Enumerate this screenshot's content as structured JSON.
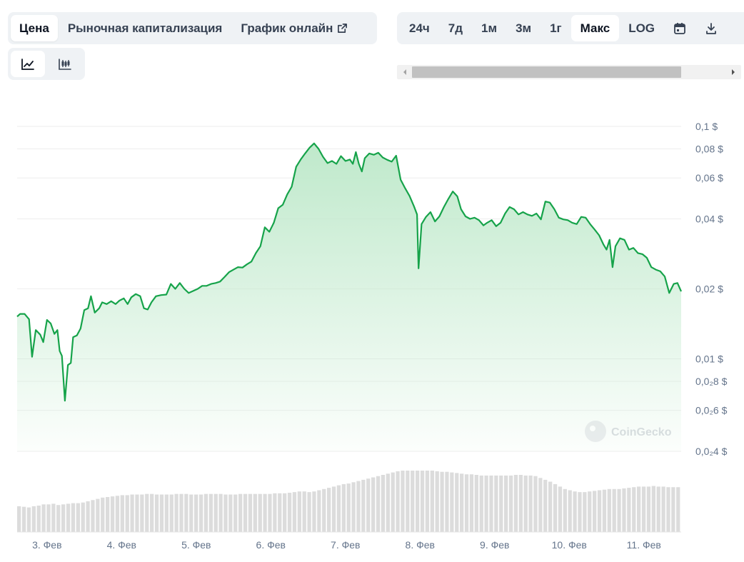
{
  "tabs": {
    "price": "Цена",
    "market_cap": "Рыночная капитализация",
    "live_chart": "График онлайн"
  },
  "chart_type_buttons": [
    {
      "name": "line-chart",
      "icon": "line-chart-icon",
      "active": true
    },
    {
      "name": "candlestick-chart",
      "icon": "candlestick-icon",
      "active": false
    }
  ],
  "ranges": [
    "24ч",
    "7д",
    "1м",
    "3м",
    "1г",
    "Макс",
    "LOG"
  ],
  "active_range": "Макс",
  "range_icons": [
    "calendar-icon",
    "download-icon"
  ],
  "watermark": "CoinGecko",
  "colors": {
    "line": "#16a34a",
    "fill_top": "#bfe9cb",
    "volume": "#dcdcdc",
    "grid": "#eeeeee",
    "axis_text": "#64748b"
  },
  "chart_data": {
    "type": "area",
    "y_scale": "log",
    "x_labels": [
      "3. Фев",
      "4. Фев",
      "5. Фев",
      "6. Фев",
      "7. Фев",
      "8. Фев",
      "9. Фев",
      "10. Фев",
      "11. Фев"
    ],
    "y_ticks": [
      {
        "value": 0.1,
        "label": "0,1 $"
      },
      {
        "value": 0.08,
        "label": "0,08 $"
      },
      {
        "value": 0.06,
        "label": "0,06 $"
      },
      {
        "value": 0.04,
        "label": "0,04 $"
      },
      {
        "value": 0.02,
        "label": "0,02 $"
      },
      {
        "value": 0.01,
        "label": "0,01 $"
      },
      {
        "value": 0.008,
        "label": "0,0₂8 $"
      },
      {
        "value": 0.006,
        "label": "0,0₂6 $"
      },
      {
        "value": 0.004,
        "label": "0,0₂4 $"
      }
    ],
    "x_range": [
      2.6,
      11.5
    ],
    "y_range": [
      0.004,
      0.1
    ],
    "series": [
      {
        "type": "line",
        "points": [
          [
            2.6,
            0.0152
          ],
          [
            2.64,
            0.0156
          ],
          [
            2.7,
            0.0156
          ],
          [
            2.76,
            0.0148
          ],
          [
            2.8,
            0.0102
          ],
          [
            2.85,
            0.0133
          ],
          [
            2.91,
            0.0127
          ],
          [
            2.95,
            0.0118
          ],
          [
            3.0,
            0.0147
          ],
          [
            3.05,
            0.0142
          ],
          [
            3.1,
            0.0128
          ],
          [
            3.14,
            0.0133
          ],
          [
            3.17,
            0.0108
          ],
          [
            3.2,
            0.0103
          ],
          [
            3.24,
            0.0066
          ],
          [
            3.28,
            0.0094
          ],
          [
            3.32,
            0.0096
          ],
          [
            3.35,
            0.0124
          ],
          [
            3.4,
            0.0126
          ],
          [
            3.45,
            0.0135
          ],
          [
            3.5,
            0.0162
          ],
          [
            3.55,
            0.0165
          ],
          [
            3.59,
            0.0186
          ],
          [
            3.64,
            0.0158
          ],
          [
            3.7,
            0.0165
          ],
          [
            3.74,
            0.0175
          ],
          [
            3.8,
            0.0172
          ],
          [
            3.86,
            0.0177
          ],
          [
            3.92,
            0.0172
          ],
          [
            3.97,
            0.0178
          ],
          [
            4.03,
            0.0182
          ],
          [
            4.08,
            0.0172
          ],
          [
            4.13,
            0.0184
          ],
          [
            4.19,
            0.019
          ],
          [
            4.25,
            0.0186
          ],
          [
            4.3,
            0.0165
          ],
          [
            4.35,
            0.0163
          ],
          [
            4.4,
            0.0175
          ],
          [
            4.46,
            0.0186
          ],
          [
            4.53,
            0.0188
          ],
          [
            4.6,
            0.0189
          ],
          [
            4.66,
            0.021
          ],
          [
            4.72,
            0.02
          ],
          [
            4.78,
            0.0212
          ],
          [
            4.84,
            0.02
          ],
          [
            4.9,
            0.0192
          ],
          [
            4.96,
            0.0196
          ],
          [
            5.02,
            0.02
          ],
          [
            5.08,
            0.0206
          ],
          [
            5.14,
            0.0206
          ],
          [
            5.2,
            0.021
          ],
          [
            5.26,
            0.0212
          ],
          [
            5.32,
            0.0215
          ],
          [
            5.38,
            0.0225
          ],
          [
            5.44,
            0.0236
          ],
          [
            5.5,
            0.0242
          ],
          [
            5.56,
            0.0248
          ],
          [
            5.62,
            0.0247
          ],
          [
            5.68,
            0.0255
          ],
          [
            5.74,
            0.0262
          ],
          [
            5.8,
            0.0285
          ],
          [
            5.86,
            0.0305
          ],
          [
            5.92,
            0.0368
          ],
          [
            5.98,
            0.0352
          ],
          [
            6.04,
            0.0385
          ],
          [
            6.1,
            0.0445
          ],
          [
            6.16,
            0.046
          ],
          [
            6.22,
            0.051
          ],
          [
            6.28,
            0.055
          ],
          [
            6.34,
            0.067
          ],
          [
            6.4,
            0.072
          ],
          [
            6.46,
            0.0765
          ],
          [
            6.52,
            0.081
          ],
          [
            6.58,
            0.0845
          ],
          [
            6.64,
            0.08
          ],
          [
            6.7,
            0.074
          ],
          [
            6.76,
            0.0695
          ],
          [
            6.82,
            0.071
          ],
          [
            6.88,
            0.069
          ],
          [
            6.94,
            0.0745
          ],
          [
            7.0,
            0.071
          ],
          [
            7.06,
            0.072
          ],
          [
            7.1,
            0.069
          ],
          [
            7.14,
            0.0775
          ],
          [
            7.18,
            0.069
          ],
          [
            7.22,
            0.064
          ],
          [
            7.26,
            0.073
          ],
          [
            7.32,
            0.0765
          ],
          [
            7.38,
            0.0755
          ],
          [
            7.44,
            0.077
          ],
          [
            7.5,
            0.0735
          ],
          [
            7.56,
            0.0718
          ],
          [
            7.62,
            0.0705
          ],
          [
            7.68,
            0.0748
          ],
          [
            7.74,
            0.059
          ],
          [
            7.8,
            0.0542
          ],
          [
            7.86,
            0.0502
          ],
          [
            7.92,
            0.0452
          ],
          [
            7.96,
            0.0418
          ],
          [
            7.98,
            0.0245
          ],
          [
            8.02,
            0.038
          ],
          [
            8.08,
            0.0408
          ],
          [
            8.14,
            0.0428
          ],
          [
            8.2,
            0.039
          ],
          [
            8.26,
            0.041
          ],
          [
            8.32,
            0.045
          ],
          [
            8.38,
            0.0488
          ],
          [
            8.44,
            0.0525
          ],
          [
            8.5,
            0.05
          ],
          [
            8.55,
            0.044
          ],
          [
            8.61,
            0.041
          ],
          [
            8.67,
            0.04
          ],
          [
            8.73,
            0.0405
          ],
          [
            8.79,
            0.0395
          ],
          [
            8.85,
            0.0375
          ],
          [
            8.9,
            0.0385
          ],
          [
            8.96,
            0.0395
          ],
          [
            9.02,
            0.0372
          ],
          [
            9.08,
            0.0385
          ],
          [
            9.14,
            0.0422
          ],
          [
            9.2,
            0.045
          ],
          [
            9.26,
            0.044
          ],
          [
            9.32,
            0.0418
          ],
          [
            9.38,
            0.0428
          ],
          [
            9.44,
            0.0418
          ],
          [
            9.5,
            0.0412
          ],
          [
            9.56,
            0.0422
          ],
          [
            9.62,
            0.0398
          ],
          [
            9.68,
            0.0475
          ],
          [
            9.74,
            0.047
          ],
          [
            9.8,
            0.044
          ],
          [
            9.86,
            0.0405
          ],
          [
            9.92,
            0.0398
          ],
          [
            9.98,
            0.0395
          ],
          [
            10.04,
            0.0385
          ],
          [
            10.1,
            0.038
          ],
          [
            10.16,
            0.0408
          ],
          [
            10.22,
            0.0405
          ],
          [
            10.28,
            0.038
          ],
          [
            10.34,
            0.036
          ],
          [
            10.4,
            0.034
          ],
          [
            10.46,
            0.031
          ],
          [
            10.5,
            0.0295
          ],
          [
            10.54,
            0.0325
          ],
          [
            10.58,
            0.0248
          ],
          [
            10.62,
            0.0305
          ],
          [
            10.68,
            0.033
          ],
          [
            10.74,
            0.0325
          ],
          [
            10.8,
            0.0295
          ],
          [
            10.86,
            0.03
          ],
          [
            10.92,
            0.0285
          ],
          [
            10.98,
            0.0282
          ],
          [
            11.04,
            0.0272
          ],
          [
            11.1,
            0.0248
          ],
          [
            11.16,
            0.0242
          ],
          [
            11.22,
            0.0238
          ],
          [
            11.28,
            0.0226
          ],
          [
            11.34,
            0.0192
          ],
          [
            11.4,
            0.021
          ],
          [
            11.45,
            0.0212
          ],
          [
            11.5,
            0.0195
          ]
        ]
      },
      {
        "type": "volume",
        "relative": [
          0.42,
          0.41,
          0.4,
          0.42,
          0.43,
          0.45,
          0.45,
          0.46,
          0.44,
          0.45,
          0.46,
          0.47,
          0.47,
          0.48,
          0.5,
          0.52,
          0.54,
          0.56,
          0.57,
          0.58,
          0.59,
          0.6,
          0.6,
          0.61,
          0.61,
          0.61,
          0.62,
          0.62,
          0.61,
          0.61,
          0.61,
          0.61,
          0.62,
          0.62,
          0.62,
          0.61,
          0.61,
          0.61,
          0.62,
          0.62,
          0.62,
          0.62,
          0.61,
          0.61,
          0.61,
          0.62,
          0.62,
          0.62,
          0.62,
          0.62,
          0.62,
          0.62,
          0.63,
          0.63,
          0.63,
          0.64,
          0.65,
          0.66,
          0.66,
          0.65,
          0.66,
          0.68,
          0.7,
          0.72,
          0.74,
          0.76,
          0.78,
          0.79,
          0.81,
          0.83,
          0.85,
          0.87,
          0.89,
          0.91,
          0.93,
          0.95,
          0.97,
          0.99,
          1.0,
          1.0,
          1.0,
          1.0,
          1.0,
          1.0,
          1.0,
          0.99,
          0.98,
          0.98,
          0.97,
          0.96,
          0.95,
          0.94,
          0.94,
          0.93,
          0.92,
          0.92,
          0.92,
          0.92,
          0.92,
          0.92,
          0.92,
          0.93,
          0.93,
          0.92,
          0.92,
          0.91,
          0.88,
          0.85,
          0.82,
          0.78,
          0.74,
          0.7,
          0.68,
          0.66,
          0.65,
          0.65,
          0.66,
          0.67,
          0.68,
          0.69,
          0.7,
          0.7,
          0.7,
          0.71,
          0.72,
          0.73,
          0.74,
          0.74,
          0.74,
          0.75,
          0.74,
          0.74,
          0.73,
          0.73,
          0.73
        ]
      }
    ]
  }
}
